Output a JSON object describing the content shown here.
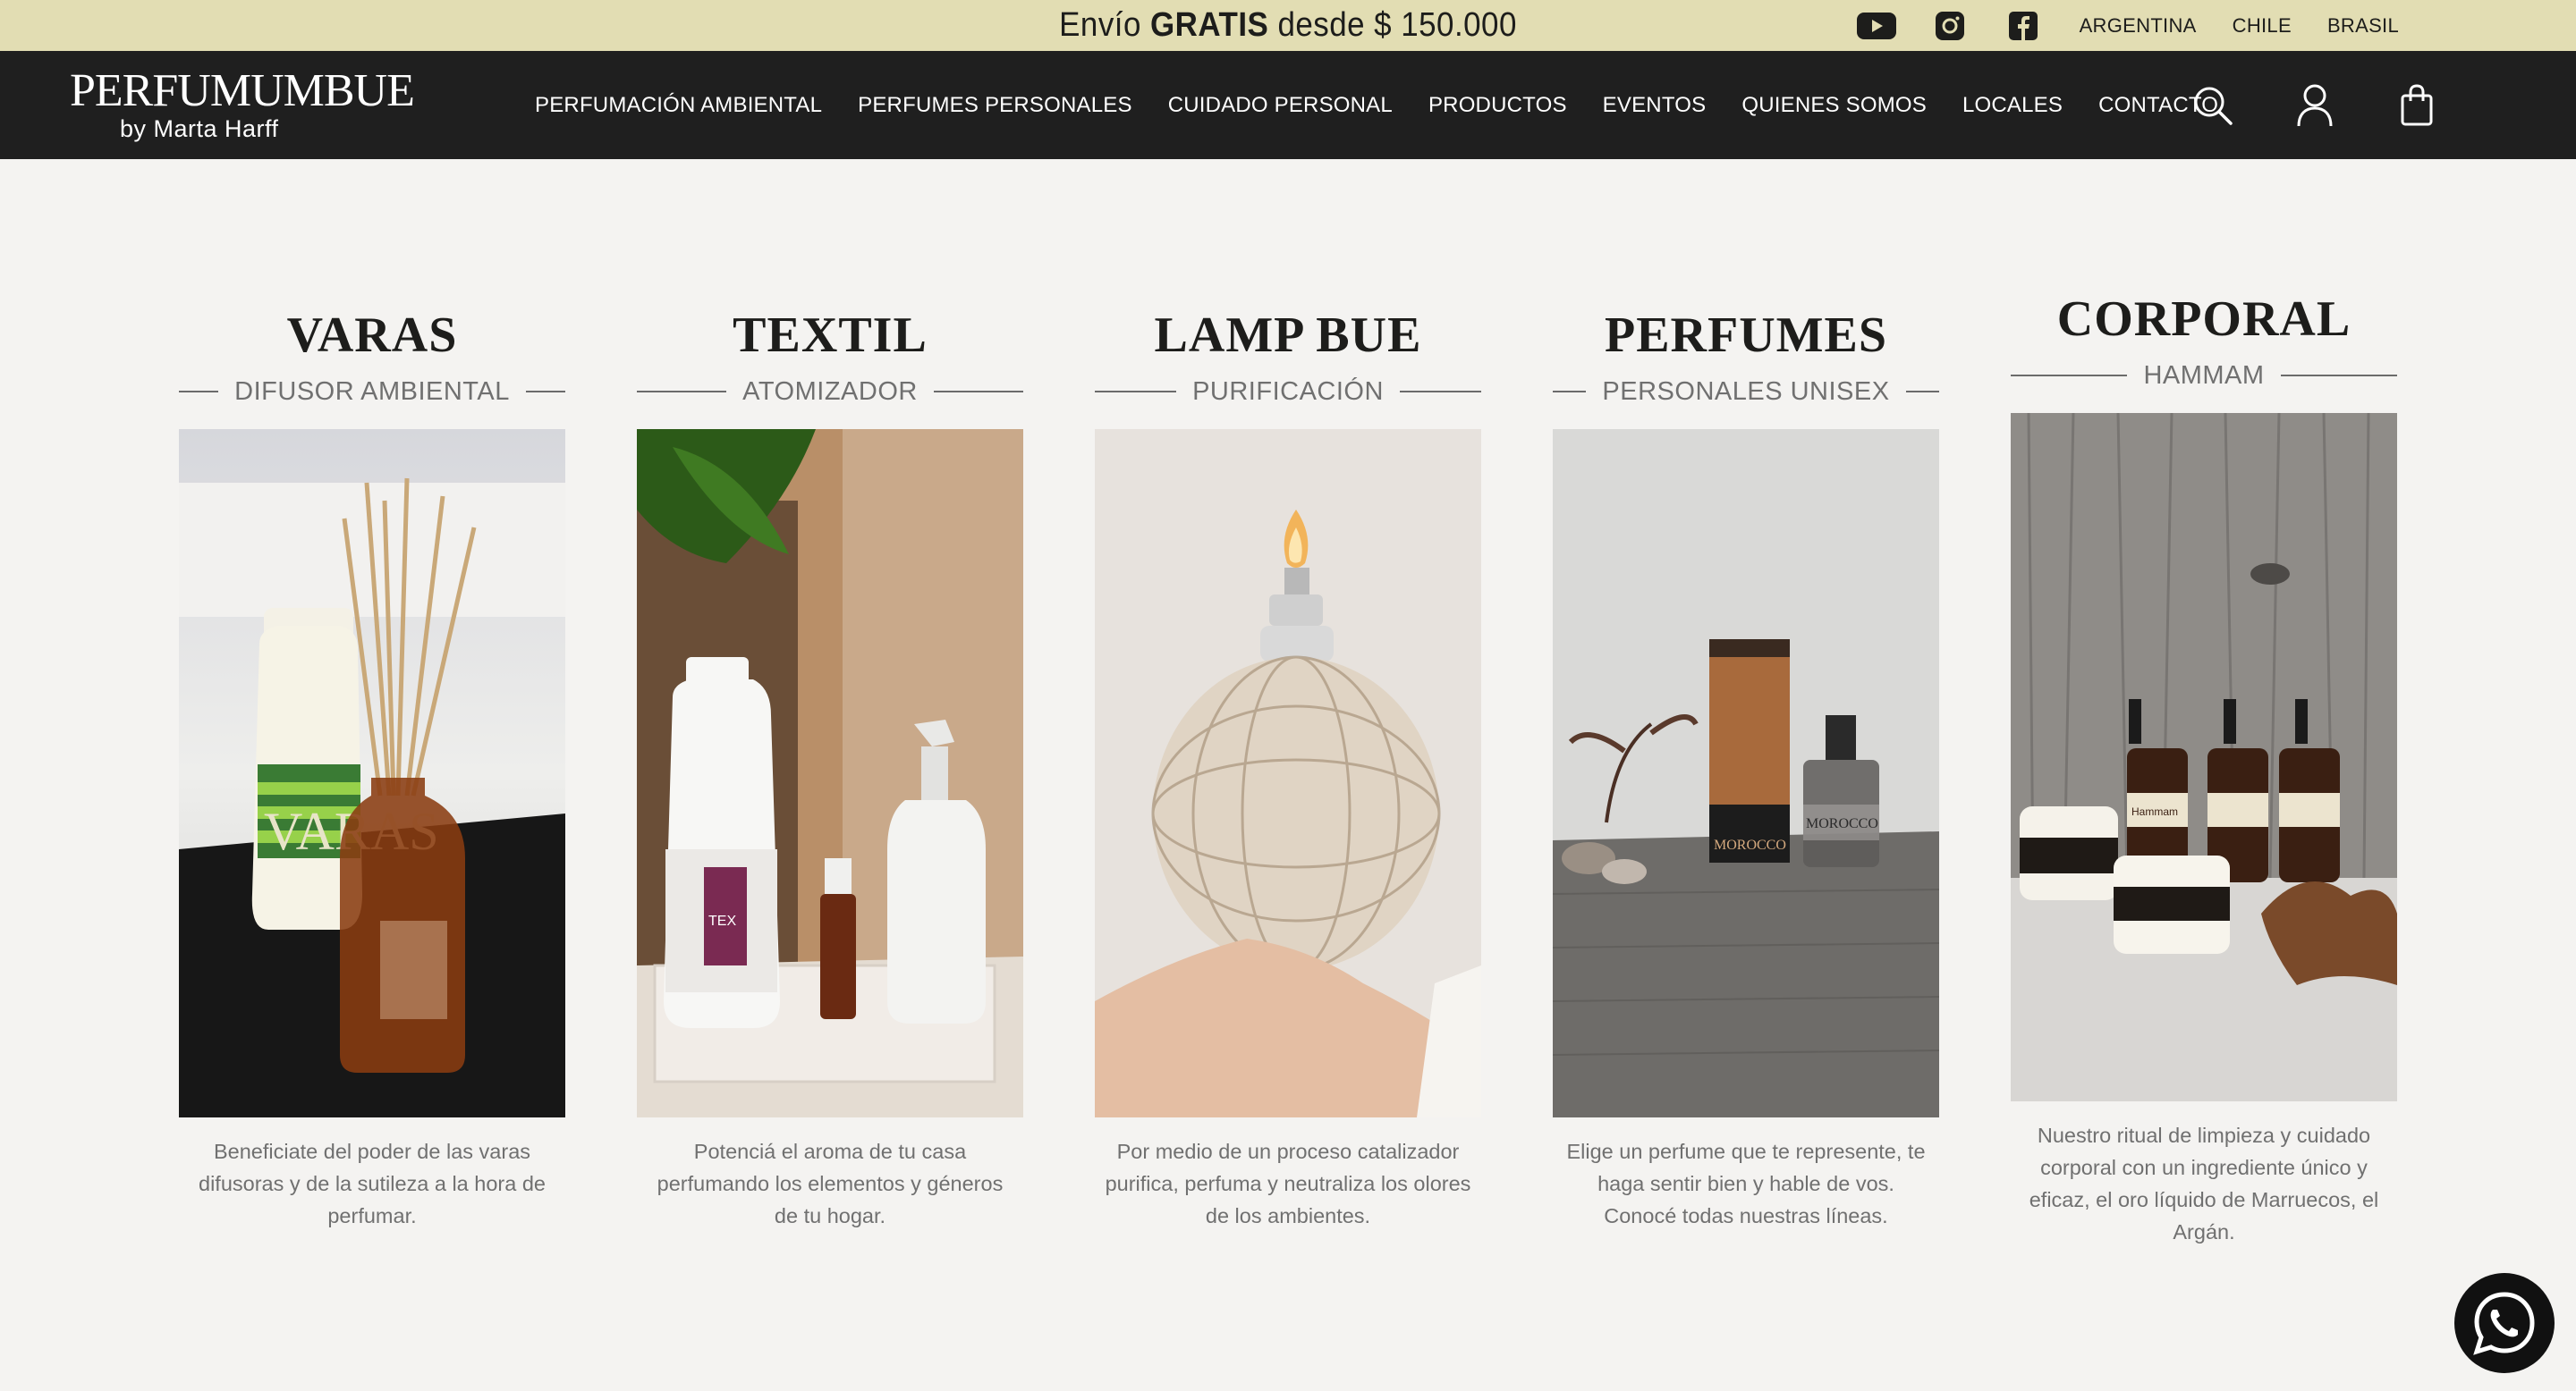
{
  "promo": {
    "prefix": "Envío ",
    "bold": "GRATIS",
    "suffix": " desde $ 150.000"
  },
  "social": [
    {
      "icon": "youtube-icon"
    },
    {
      "icon": "instagram-icon"
    },
    {
      "icon": "facebook-icon"
    }
  ],
  "countries": [
    "ARGENTINA",
    "CHILE",
    "BRASIL"
  ],
  "logo": {
    "main": "PERFUMUMBUE",
    "sub": "by Marta Harff"
  },
  "menu": [
    "PERFUMACIÓN AMBIENTAL",
    "PERFUMES PERSONALES",
    "CUIDADO PERSONAL",
    "PRODUCTOS",
    "EVENTOS",
    "QUIENES SOMOS",
    "LOCALES",
    "CONTACTO"
  ],
  "nav_icons": [
    "search-icon",
    "user-icon",
    "cart-icon"
  ],
  "cards": [
    {
      "title": "VARAS",
      "subtitle": "DIFUSOR AMBIENTAL",
      "description": "Beneficiate del poder de las varas difusoras y de la sutileza a la hora de perfumar."
    },
    {
      "title": "TEXTIL",
      "subtitle": "ATOMIZADOR",
      "description": "Potenciá el aroma de tu casa perfumando los elementos y géneros de tu hogar."
    },
    {
      "title": "LAMP BUE",
      "subtitle": "PURIFICACIÓN",
      "description": "Por medio de un proceso catalizador purifica, perfuma y neutraliza los olores de los ambientes."
    },
    {
      "title": "PERFUMES",
      "subtitle": "PERSONALES UNISEX",
      "description": "Elige un perfume que te represente, te haga sentir bien y hable de vos. Conocé todas nuestras líneas."
    },
    {
      "title": "CORPORAL",
      "subtitle": "HAMMAM",
      "description": "Nuestro ritual de limpieza y cuidado corporal con un ingrediente único y eficaz, el oro líquido de Marruecos, el Argán."
    }
  ],
  "product_labels": {
    "varas": "VARAS",
    "moroccan_1": "MOROCCO",
    "moroccan_2": "MOROCCO",
    "textil": "TEX",
    "hammam": "Hammam"
  },
  "colors": {
    "topbar": "#e2ddb3",
    "nav": "#1f1f1f",
    "page": "#f4f3f1",
    "text_muted": "#707070"
  },
  "whatsapp": {
    "icon": "whatsapp-icon"
  }
}
